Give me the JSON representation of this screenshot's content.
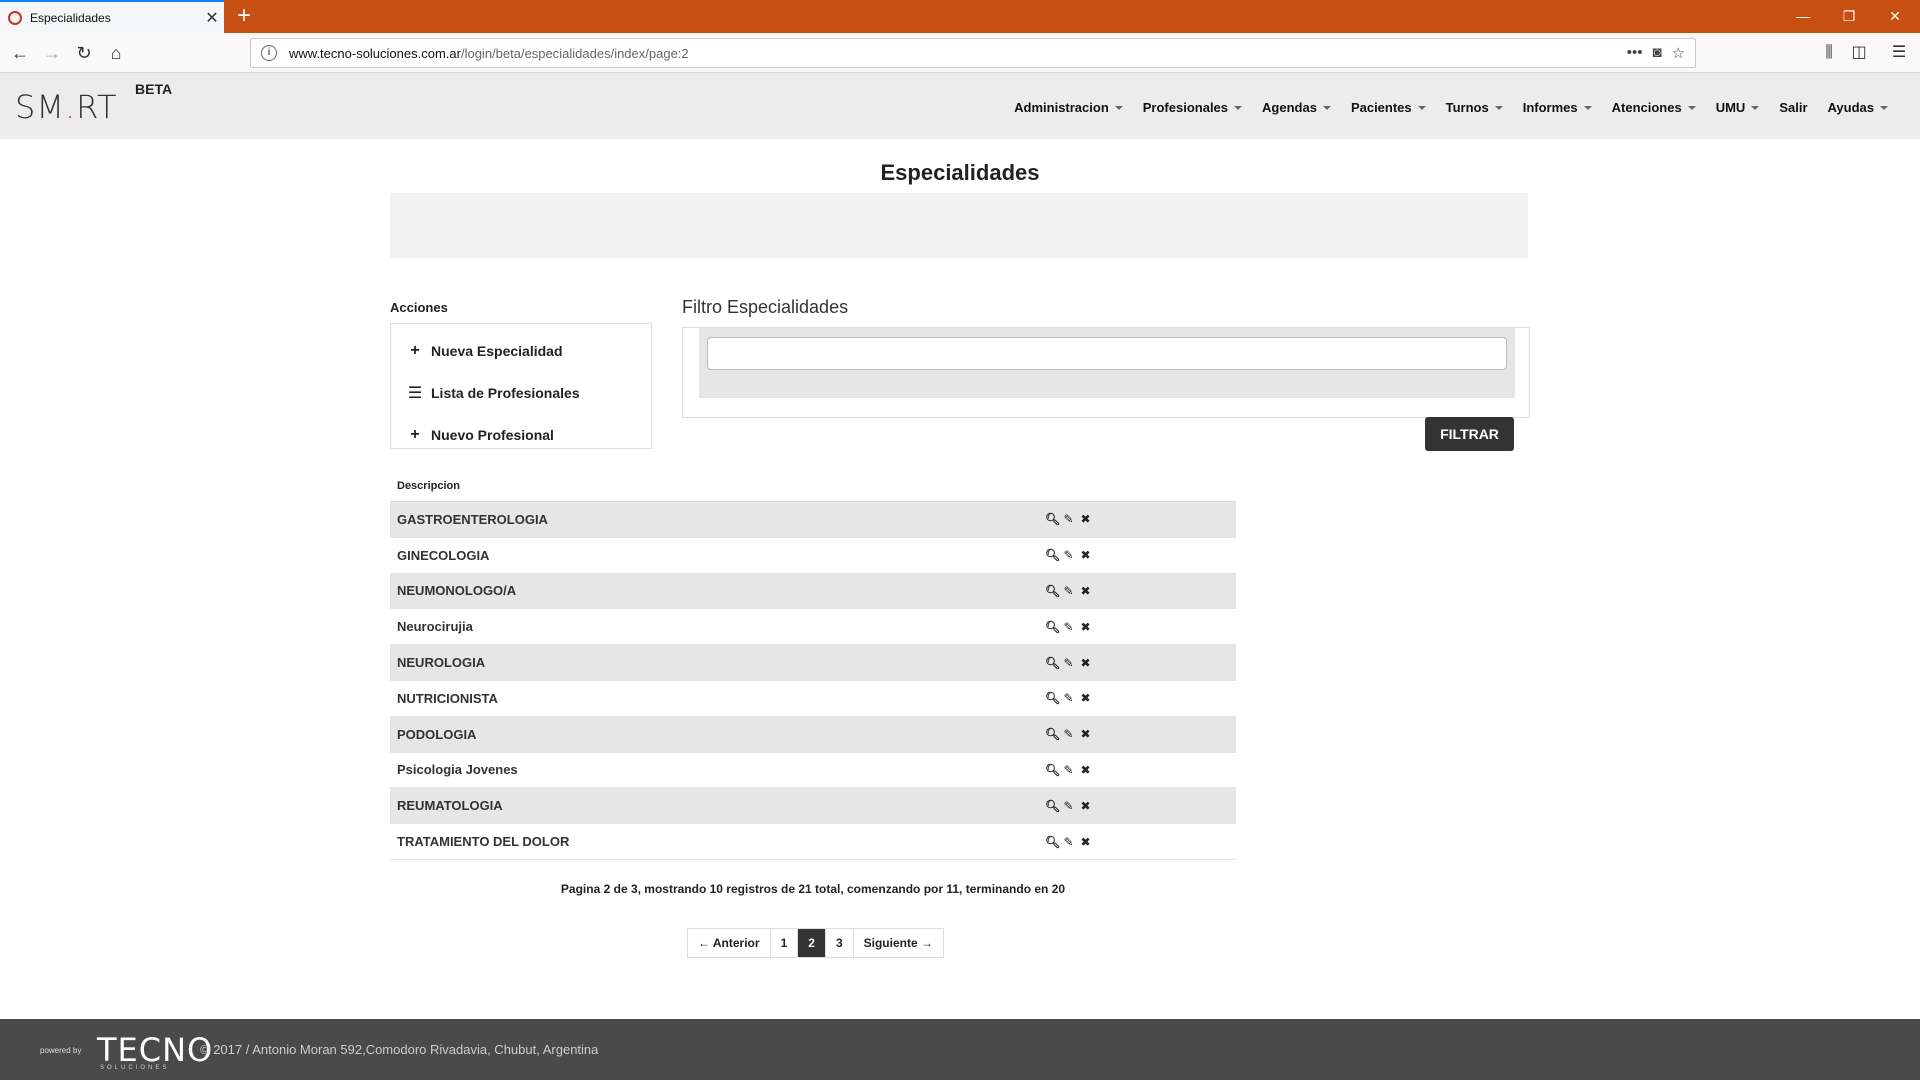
{
  "browser": {
    "tab_title": "Especialidades",
    "url_host": "www.tecno-soluciones.com.ar",
    "url_path": "/login/beta/especialidades/index/page:2"
  },
  "header": {
    "logo_text_pre": "SM",
    "logo_text_post": "RT",
    "logo_dot": ".",
    "beta": "BETA",
    "menu": [
      "Administracion",
      "Profesionales",
      "Agendas",
      "Pacientes",
      "Turnos",
      "Informes",
      "Atenciones",
      "UMU",
      "Salir",
      "Ayudas"
    ]
  },
  "page": {
    "title": "Especialidades"
  },
  "actions": {
    "label": "Acciones",
    "items": [
      {
        "label": "Nueva Especialidad",
        "icon": "plus-icon"
      },
      {
        "label": "Lista de Profesionales",
        "icon": "list-icon"
      },
      {
        "label": "Nuevo Profesional",
        "icon": "plus-icon"
      }
    ]
  },
  "filter": {
    "label": "Filtro Especialidades",
    "value": "",
    "button": "FILTRAR"
  },
  "table": {
    "header": "Descripcion",
    "rows": [
      "GASTROENTEROLOGIA",
      "GINECOLOGIA",
      "NEUMONOLOGO/A",
      "Neurocirujia",
      "NEUROLOGIA",
      "NUTRICIONISTA",
      "PODOLOGIA",
      "Psicologia Jovenes",
      "REUMATOLOGIA",
      "TRATAMIENTO DEL DOLOR"
    ]
  },
  "pager": {
    "info": "Pagina 2 de 3, mostrando 10 registros de 21 total, comenzando por 11, terminando en 20",
    "prev": "← Anterior",
    "pages": [
      "1",
      "2",
      "3"
    ],
    "current": "2",
    "next": "Siguiente →"
  },
  "footer": {
    "powered": "powered by",
    "brand": "TECNO",
    "brand_sub": "SOLUCIONES",
    "copyright": "© 2017 / Antonio Moran 592,Comodoro Rivadavia, Chubut, Argentina"
  },
  "colors": {
    "titlebar": "#c84f12",
    "accent_dark": "#333333",
    "footer": "#4a4a4a"
  }
}
